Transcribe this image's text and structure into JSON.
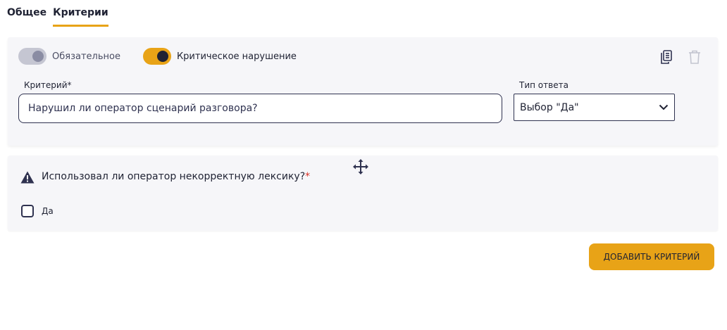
{
  "tabs": [
    {
      "label": "Общее",
      "active": false
    },
    {
      "label": "Критерии",
      "active": true
    }
  ],
  "criterion_card": {
    "mandatory_toggle": {
      "label": "Обязательное",
      "on": false
    },
    "critical_toggle": {
      "label": "Критическое нарушение",
      "on": true
    },
    "criterion_label": "Критерий*",
    "criterion_value": "Нарушил ли оператор сценарий разговора?",
    "answer_type_label": "Тип ответа",
    "answer_type_value": "Выбор \"Да\"",
    "icons": {
      "copy": "copy-icon",
      "delete": "trash-icon",
      "dropdown": "chevron-down-icon"
    }
  },
  "preview_card": {
    "question": "Использовал ли оператор некорректную лексику?",
    "required_mark": "*",
    "checkbox_label": "Да",
    "checked": false,
    "icons": {
      "drag": "move-icon",
      "warning": "warning-icon"
    }
  },
  "add_button_label": "ДОБАВИТЬ КРИТЕРИЙ",
  "colors": {
    "accent": "#e8a317",
    "dark": "#1f2233",
    "card_bg": "#f6f6f9",
    "required": "#d93025"
  }
}
